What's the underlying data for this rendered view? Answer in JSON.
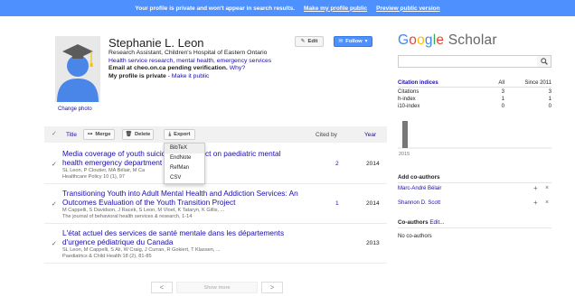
{
  "banner": {
    "message": "Your profile is private and won't appear in search results.",
    "make_public": "Make my profile public",
    "preview": "Preview public version"
  },
  "profile": {
    "name": "Stephanie L. Leon",
    "affiliation": "Research Assistant, Children's Hospital of Eastern Ontario",
    "interests": "Health service research, mental health, emergency services",
    "email_prefix": "Email at cheo.on.ca pending verification.",
    "email_why": "Why?",
    "private_prefix": "My profile is private",
    "private_link": "- Make it public",
    "change_photo": "Change photo",
    "edit_label": "Edit",
    "follow_label": "Follow"
  },
  "toolbar": {
    "title_col": "Title",
    "merge": "Merge",
    "delete": "Delete",
    "export": "Export",
    "cited_by": "Cited by",
    "year": "Year"
  },
  "export_menu": [
    "BibTeX",
    "EndNote",
    "RefMan",
    "CSV"
  ],
  "articles": [
    {
      "title1": "Media coverage of youth suicid",
      "title1_tail": "ct on paediatric mental",
      "title2": "health emergency department",
      "authors": "SL Leon, P Cloutier, MA Bélair, M Ca",
      "venue": "Healthcare Policy 10 (1), 97",
      "cited": "2",
      "year": "2014"
    },
    {
      "title1": "Transitioning Youth into Adult Mental Health and Addiction Services: An",
      "title2": "Outcomes Evaluation of the Youth Transition Project",
      "authors": "M Cappelli, S Davidson, J Racek, S Leon, M Vloet, K Tataryn, K Gillis, ...",
      "venue": "The journal of behavioral health services & research, 1-14",
      "cited": "1",
      "year": "2014"
    },
    {
      "title1": "L'état actuel des services de santé mentale dans les départements",
      "title2": "d'urgence pédiatrique du Canada",
      "authors": "SL Leon, M Cappelli, S Ali, W Craig, J Curran, R Gokiert, T Klassen, ...",
      "venue": "Paediatrics & Child Health 18 (2), 81-85",
      "cited": "",
      "year": "2013"
    }
  ],
  "pager": {
    "show_more": "Show more",
    "prev": "<",
    "next": ">"
  },
  "scholar": {
    "logo_google": [
      "G",
      "o",
      "o",
      "g",
      "l",
      "e"
    ],
    "logo_scholar": "Scholar",
    "search_placeholder": ""
  },
  "citation_indices": {
    "header": [
      "Citation indices",
      "All",
      "Since 2011"
    ],
    "rows": [
      [
        "Citations",
        "3",
        "3"
      ],
      [
        "h-index",
        "1",
        "1"
      ],
      [
        "i10-index",
        "0",
        "0"
      ]
    ]
  },
  "chart_data": {
    "type": "bar",
    "categories": [
      "2015"
    ],
    "values": [
      3
    ],
    "ylim": [
      0,
      3
    ],
    "bar_color": "#777777"
  },
  "coauthors_add": {
    "title": "Add co-authors",
    "items": [
      "Marc-André Bélair",
      "Shannon D. Scott"
    ],
    "add_symbol": "+",
    "remove_symbol": "×"
  },
  "coauthors": {
    "title": "Co-authors",
    "edit": "Edit...",
    "empty": "No co-authors"
  },
  "colors": {
    "banner": "#4d90fe",
    "link": "#1a0dab",
    "follow_button": "#4d90fe"
  }
}
